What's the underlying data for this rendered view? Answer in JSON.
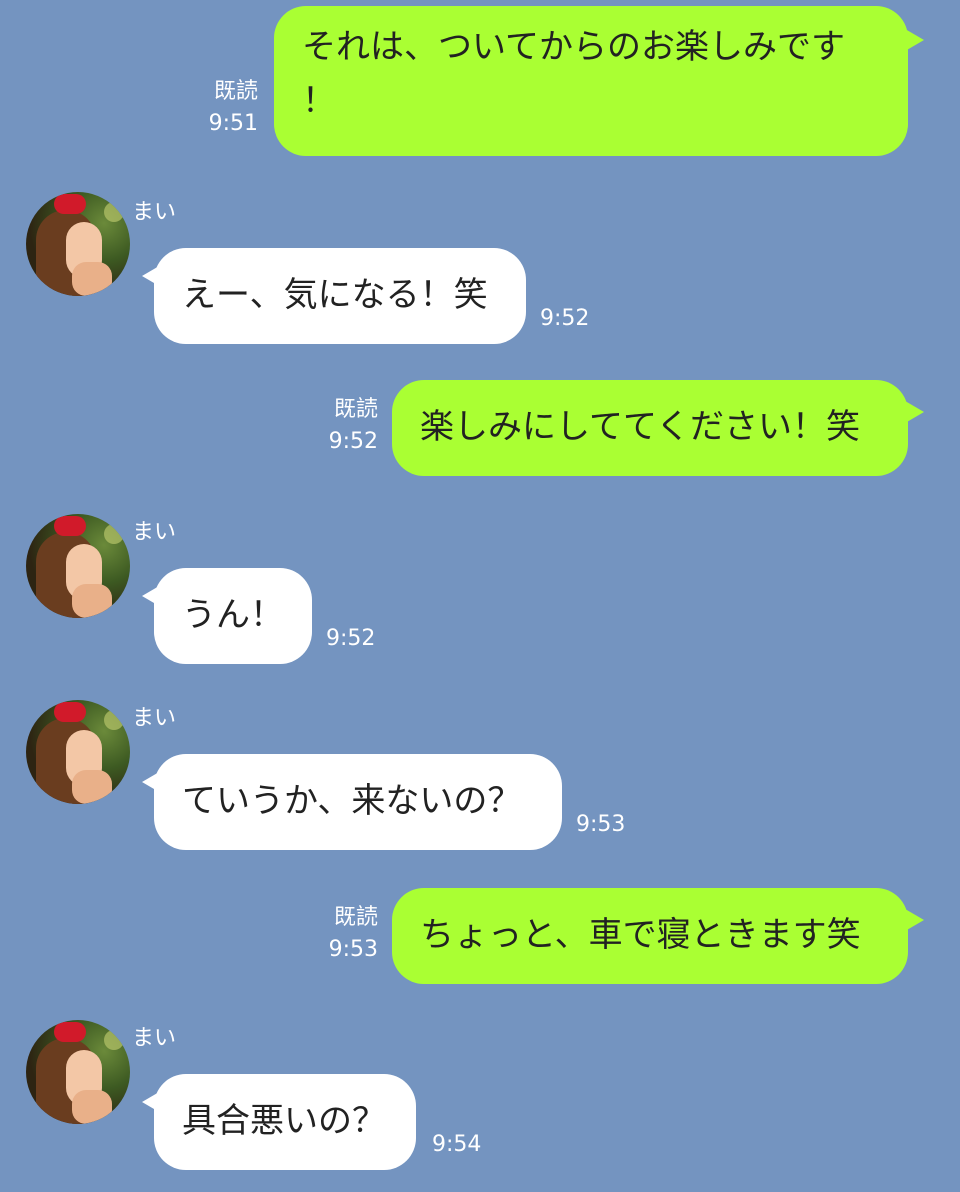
{
  "messages": [
    {
      "side": "out",
      "text": "それは、ついてからのお楽しみです\n！",
      "read": "既読",
      "time": "9:51"
    },
    {
      "side": "in",
      "sender": "まい",
      "text": "えー、気になる！笑",
      "time": "9:52"
    },
    {
      "side": "out",
      "text": "楽しみにしててください！笑",
      "read": "既読",
      "time": "9:52"
    },
    {
      "side": "in",
      "sender": "まい",
      "text": "うん！",
      "time": "9:52"
    },
    {
      "side": "in",
      "sender": "まい",
      "text": "ていうか、来ないの？",
      "time": "9:53"
    },
    {
      "side": "out",
      "text": "ちょっと、車で寝ときます笑",
      "read": "既読",
      "time": "9:53"
    },
    {
      "side": "in",
      "sender": "まい",
      "text": "具合悪いの？",
      "time": "9:54"
    }
  ],
  "colors": {
    "background": "#7494c0",
    "outgoing_bubble": "#aaff33",
    "incoming_bubble": "#ffffff"
  }
}
